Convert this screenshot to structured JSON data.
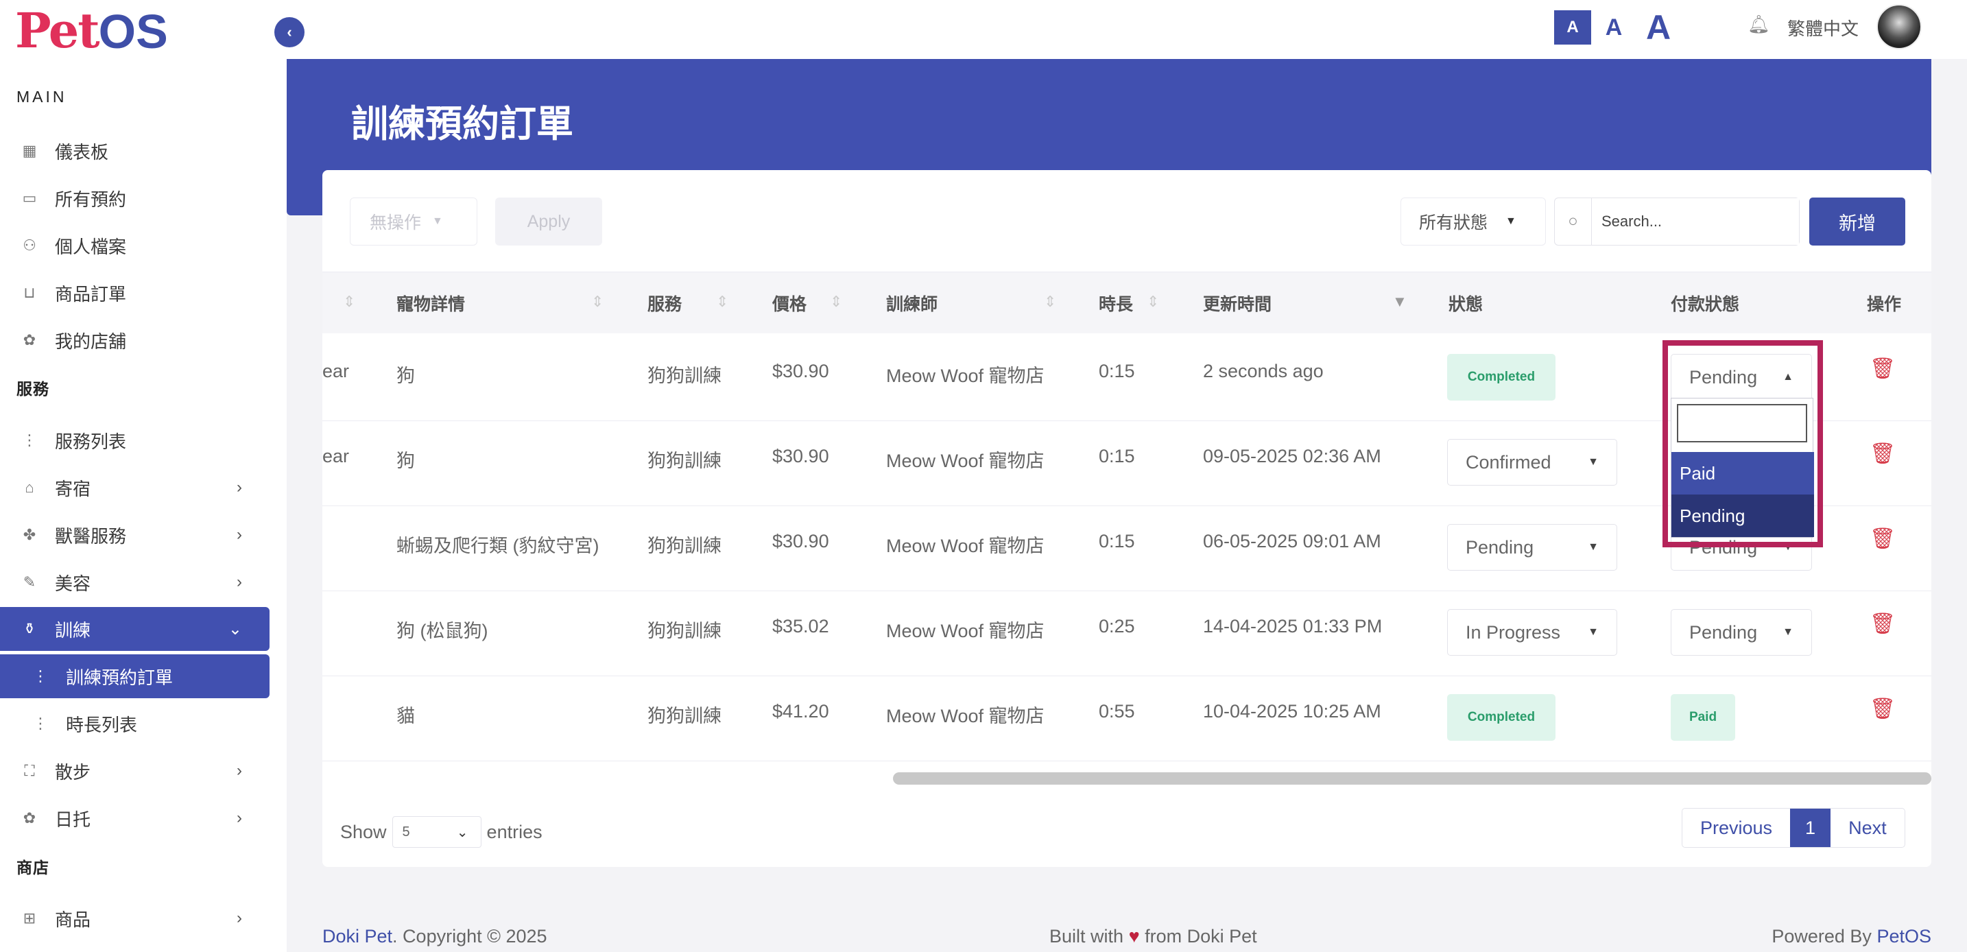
{
  "app": {
    "logo_pet": "Pet",
    "logo_os": "OS"
  },
  "sidebar": {
    "section_main": "MAIN",
    "section_service": "服務",
    "section_shop": "商店",
    "main_items": [
      {
        "label": "儀表板",
        "icon": "grid-icon"
      },
      {
        "label": "所有預約",
        "icon": "calendar-icon"
      },
      {
        "label": "個人檔案",
        "icon": "user-icon"
      },
      {
        "label": "商品訂單",
        "icon": "bag-icon"
      },
      {
        "label": "我的店舖",
        "icon": "store-icon"
      }
    ],
    "service_items": [
      {
        "label": "服務列表",
        "icon": "list-icon"
      },
      {
        "label": "寄宿",
        "icon": "home-icon"
      },
      {
        "label": "獸醫服務",
        "icon": "vet-icon"
      },
      {
        "label": "美容",
        "icon": "scissors-icon"
      },
      {
        "label": "訓練",
        "icon": "training-icon"
      },
      {
        "label": "訓練預約訂單",
        "icon": "list-icon"
      },
      {
        "label": "時長列表",
        "icon": "list-icon"
      },
      {
        "label": "散步",
        "icon": "walk-icon"
      },
      {
        "label": "日托",
        "icon": "daycare-icon"
      }
    ],
    "shop_items": [
      {
        "label": "商品",
        "icon": "shop-icon"
      }
    ]
  },
  "header": {
    "font_small": "A",
    "font_medium": "A",
    "font_large": "A",
    "language": "繁體中文"
  },
  "page": {
    "title": "訓練預約訂單"
  },
  "toolbar": {
    "bulk_action": "無操作",
    "apply": "Apply",
    "status_filter": "所有狀態",
    "search_placeholder": "Search...",
    "add": "新增"
  },
  "table": {
    "headers": [
      "寵物詳情",
      "服務",
      "價格",
      "訓練師",
      "時長",
      "更新時間",
      "狀態",
      "付款狀態",
      "操作"
    ],
    "rows": [
      {
        "prefix": "ear",
        "pet": "狗",
        "service": "狗狗訓練",
        "price": "$30.90",
        "trainer": "Meow Woof 寵物店",
        "duration": "0:15",
        "updated": "2 seconds ago",
        "status": "Completed",
        "payment": "Pending"
      },
      {
        "prefix": "ear",
        "pet": "狗",
        "service": "狗狗訓練",
        "price": "$30.90",
        "trainer": "Meow Woof 寵物店",
        "duration": "0:15",
        "updated": "09-05-2025 02:36 AM",
        "status": "Confirmed",
        "payment": ""
      },
      {
        "prefix": "",
        "pet": "蜥蜴及爬行類 (豹紋守宮)",
        "service": "狗狗訓練",
        "price": "$30.90",
        "trainer": "Meow Woof 寵物店",
        "duration": "0:15",
        "updated": "06-05-2025 09:01 AM",
        "status": "Pending",
        "payment": "Pending"
      },
      {
        "prefix": "",
        "pet": "狗 (松鼠狗)",
        "service": "狗狗訓練",
        "price": "$35.02",
        "trainer": "Meow Woof 寵物店",
        "duration": "0:25",
        "updated": "14-04-2025 01:33 PM",
        "status": "In Progress",
        "payment": "Pending"
      },
      {
        "prefix": "",
        "pet": "貓",
        "service": "狗狗訓練",
        "price": "$41.20",
        "trainer": "Meow Woof 寵物店",
        "duration": "0:55",
        "updated": "10-04-2025 10:25 AM",
        "status": "Completed",
        "payment": "Paid"
      }
    ]
  },
  "dropdown": {
    "options": [
      "Paid",
      "Pending"
    ]
  },
  "footer_controls": {
    "show": "Show",
    "entries_value": "5",
    "entries": "entries",
    "previous": "Previous",
    "page": "1",
    "next": "Next"
  },
  "footer": {
    "brand": "Doki Pet",
    "copyright": ". Copyright © 2025",
    "built_pre": "Built with",
    "built_post": "from Doki Pet",
    "powered_pre": "Powered By",
    "powered_brand": "PetOS"
  },
  "colors": {
    "primary": "#4150b0",
    "danger": "#d63c4a",
    "success_bg": "#dff5ec",
    "highlight": "#b5245a"
  }
}
